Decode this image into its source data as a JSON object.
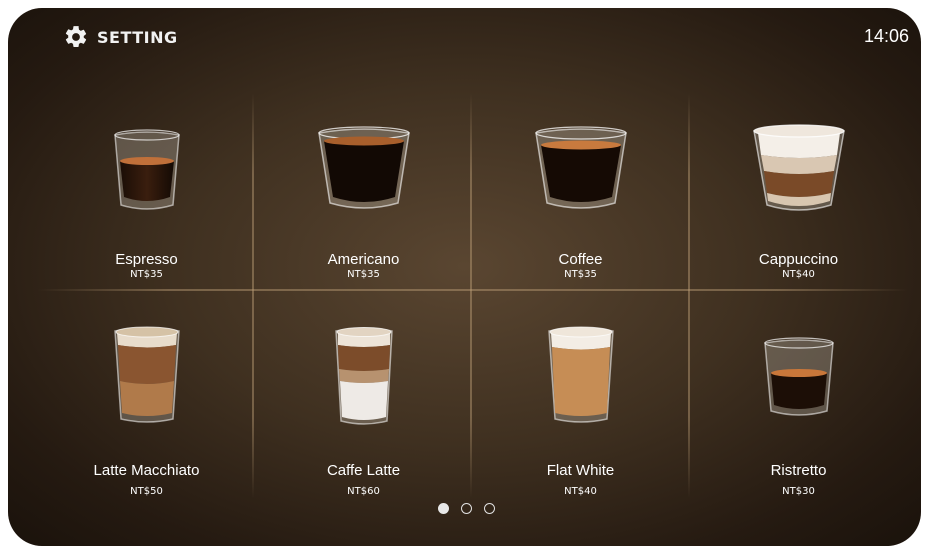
{
  "header": {
    "setting_label": "SETTING",
    "time": "14:06"
  },
  "drinks": [
    {
      "name": "Espresso",
      "price": "NT$35"
    },
    {
      "name": "Americano",
      "price": "NT$35"
    },
    {
      "name": "Coffee",
      "price": "NT$35"
    },
    {
      "name": "Cappuccino",
      "price": "NT$40"
    },
    {
      "name": "Latte Macchiato",
      "price": "NT$50"
    },
    {
      "name": "Caffe Latte",
      "price": "NT$60"
    },
    {
      "name": "Flat White",
      "price": "NT$40"
    },
    {
      "name": "Ristretto",
      "price": "NT$30"
    }
  ],
  "pagination": {
    "pages": 3,
    "current": 1
  },
  "icons": {
    "setting": "gear-icon"
  }
}
